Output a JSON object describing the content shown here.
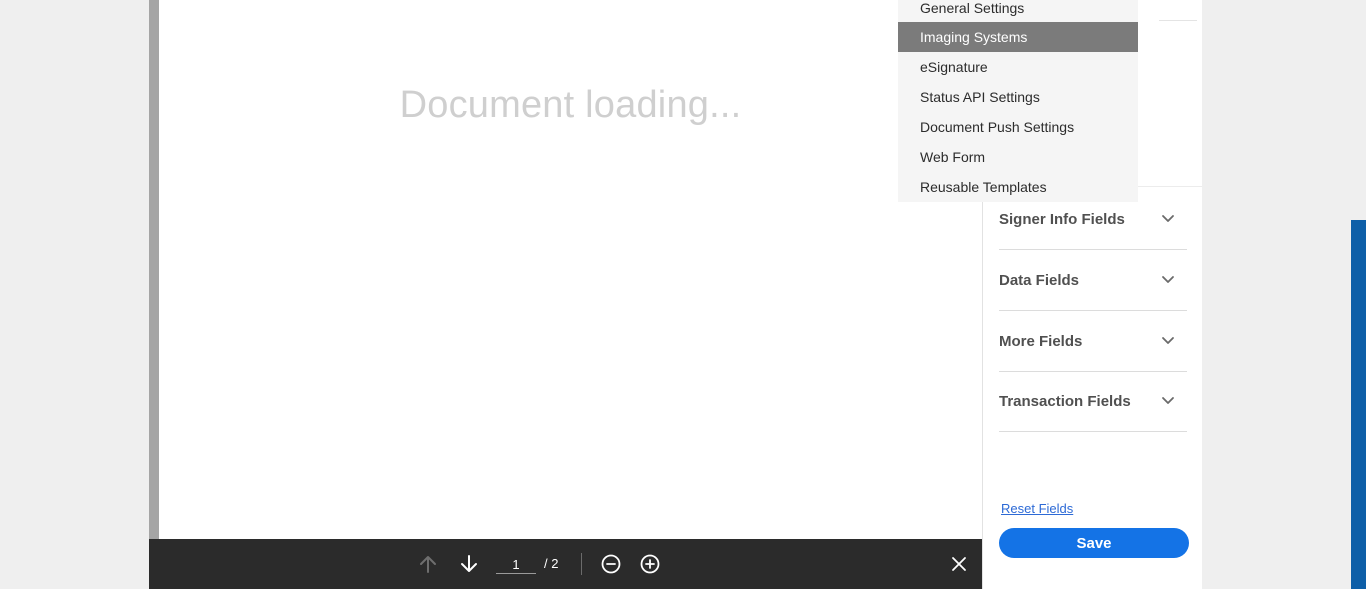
{
  "document": {
    "loading_text": "Document loading..."
  },
  "toolbar": {
    "current_page": "1",
    "total_pages": "/ 2",
    "icons": [
      "arrow-up-icon",
      "arrow-down-icon",
      "zoom-out-icon",
      "zoom-in-icon",
      "close-icon"
    ]
  },
  "dropdown": {
    "items": [
      {
        "label": "General Settings"
      },
      {
        "label": "Imaging Systems"
      },
      {
        "label": "eSignature"
      },
      {
        "label": "Status API Settings"
      },
      {
        "label": "Document Push Settings"
      },
      {
        "label": "Web Form"
      },
      {
        "label": "Reusable Templates"
      }
    ],
    "active": "Imaging Systems"
  },
  "fields_panel": {
    "sections": [
      {
        "title": "Signer Info Fields"
      },
      {
        "title": "Data Fields"
      },
      {
        "title": "More Fields"
      },
      {
        "title": "Transaction Fields"
      }
    ],
    "reset_label": "Reset Fields",
    "save_label": "Save"
  },
  "colors": {
    "accent": "#1473e6",
    "toolbar_bg": "#2b2b2b",
    "menu_active": "#7b7b7b",
    "side_bar": "#0e5fa8"
  }
}
